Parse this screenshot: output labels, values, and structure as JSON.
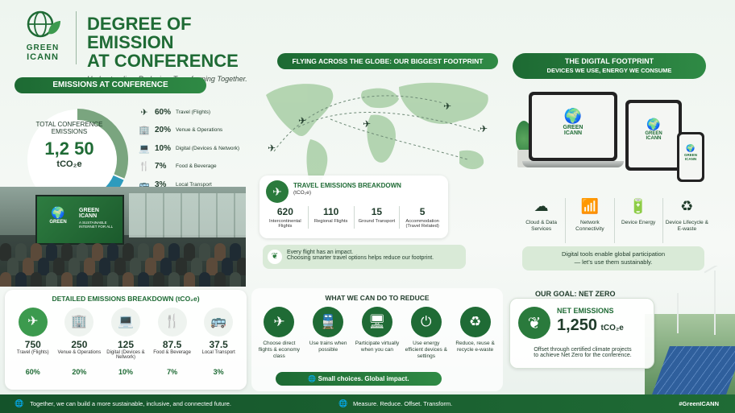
{
  "header": {
    "logo_top": "GREEN",
    "logo_bottom": "ICANN",
    "title_line1": "DEGREE OF EMISSION",
    "title_line2": "AT CONFERENCE",
    "tagline": "Understanding. Reducing. Transforming Together."
  },
  "emissions_panel": {
    "title": "EMISSIONS AT CONFERENCE",
    "total_label_1": "TOTAL CONFERENCE",
    "total_label_2": "EMISSIONS",
    "total_value": "1,2 50",
    "total_unit": "tCO₂e",
    "legend": [
      {
        "pct": "60%",
        "label": "Travel (Flights)",
        "icon": "plane-icon",
        "color": "#7aa57f"
      },
      {
        "pct": "20%",
        "label": "Venue & Operations",
        "icon": "building-icon",
        "color": "#2e9bbd"
      },
      {
        "pct": "10%",
        "label": "Digital (Devices & Network)",
        "icon": "laptop-icon",
        "color": "#1f6b35"
      },
      {
        "pct": "7%",
        "label": "Food & Beverage",
        "icon": "cutlery-icon",
        "color": "#e8b84a"
      },
      {
        "pct": "3%",
        "label": "Local Transport",
        "icon": "bus-icon",
        "color": "#b7c3bd"
      }
    ],
    "donut_values": [
      60,
      20,
      10,
      7,
      3
    ],
    "screen_logo_top": "GREEN",
    "screen_logo_bottom": "ICANN",
    "screen_text": "A SUSTAINABLE INTERNET FOR ALL"
  },
  "detailed": {
    "title": "DETAILED EMISSIONS BREAKDOWN (tCO₂e)",
    "items": [
      {
        "value": "750",
        "label": "Travel (Flights)",
        "pct": "60%",
        "icon": "plane-icon"
      },
      {
        "value": "250",
        "label": "Venue & Operations",
        "pct": "20%",
        "icon": "building-icon"
      },
      {
        "value": "125",
        "label": "Digital (Devices & Network)",
        "pct": "10%",
        "icon": "laptop-icon"
      },
      {
        "value": "87.5",
        "label": "Food & Beverage",
        "pct": "7%",
        "icon": "cutlery-icon"
      },
      {
        "value": "37.5",
        "label": "Local Transport",
        "pct": "3%",
        "icon": "bus-icon"
      }
    ]
  },
  "flights": {
    "banner": "FLYING ACROSS THE GLOBE: OUR BIGGEST FOOTPRINT",
    "breakdown_title": "TRAVEL EMISSIONS BREAKDOWN",
    "breakdown_unit": "(tCO₂e)",
    "stats": [
      {
        "value": "620",
        "label": "Intercontinental Flights"
      },
      {
        "value": "110",
        "label": "Regional Flights"
      },
      {
        "value": "15",
        "label": "Ground Transport"
      },
      {
        "value": "5",
        "label": "Accommodation (Travel Related)"
      }
    ],
    "impact_line1": "Every flight has an impact.",
    "impact_line2": "Choosing smarter travel options helps reduce our footprint."
  },
  "reduce": {
    "title": "WHAT WE CAN DO TO REDUCE",
    "items": [
      {
        "label": "Choose direct flights & economy class",
        "icon": "plane-icon"
      },
      {
        "label": "Use trains when possible",
        "icon": "train-icon"
      },
      {
        "label": "Participate virtually when you can",
        "icon": "video-call-icon"
      },
      {
        "label": "Use energy efficient devices & settings",
        "icon": "power-monitor-icon"
      },
      {
        "label": "Reduce, reuse & recycle e-waste",
        "icon": "recycle-icon"
      }
    ],
    "tagline": "Small choices. Global impact."
  },
  "digital": {
    "title_line1": "THE DIGITAL FOOTPRINT",
    "title_line2": "DEVICES WE USE, ENERGY WE CONSUME",
    "device_logo_top": "GREEN",
    "device_logo_bottom": "ICANN",
    "items": [
      {
        "label": "Cloud & Data Services",
        "icon": "cloud-icon"
      },
      {
        "label": "Network Connectivity",
        "icon": "wifi-icon"
      },
      {
        "label": "Device Energy",
        "icon": "battery-icon"
      },
      {
        "label": "Device Lifecycle & E-waste",
        "icon": "recycle-icon"
      }
    ],
    "note_line1": "Digital tools enable global participation",
    "note_line2": "— let’s use them sustainably."
  },
  "goal": {
    "title": "OUR GOAL: NET ZERO",
    "net_label": "NET EMISSIONS",
    "net_value": "1,250",
    "net_unit": "tCO₂e",
    "desc_line1": "Offset through certified climate projects",
    "desc_line2": "to achieve Net Zero for the conference."
  },
  "footer": {
    "left": "Together, we can build a more sustainable, inclusive, and connected future.",
    "middle": "Measure. Reduce. Offset. Transform.",
    "right": "#GreenICANN"
  }
}
